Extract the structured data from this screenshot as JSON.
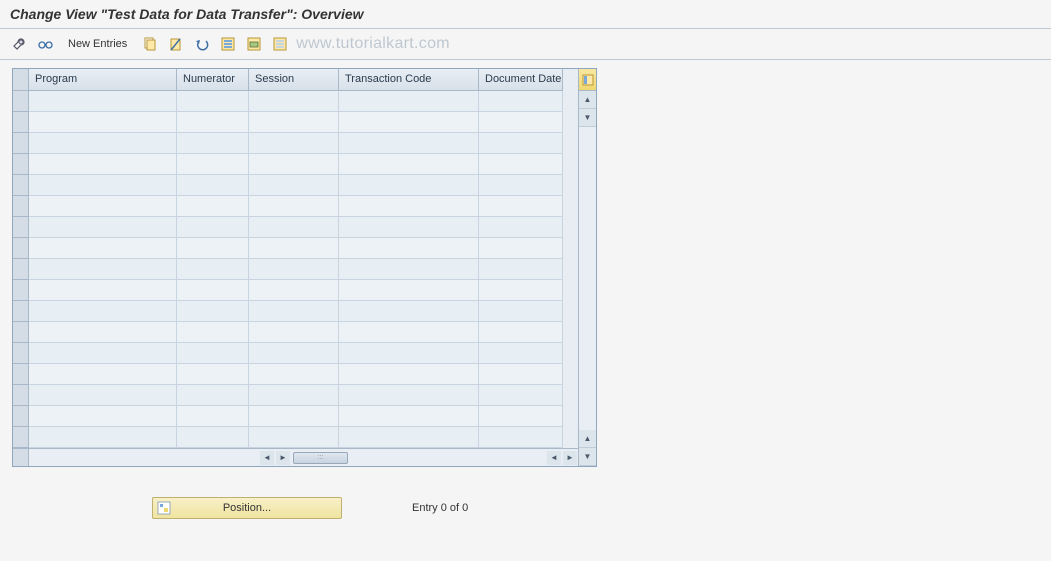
{
  "title": "Change View \"Test Data for Data Transfer\": Overview",
  "toolbar": {
    "new_entries_label": "New Entries"
  },
  "watermark": "www.tutorialkart.com",
  "grid": {
    "columns": {
      "program": "Program",
      "numerator": "Numerator",
      "session": "Session",
      "transaction_code": "Transaction Code",
      "document_date": "Document Date"
    },
    "rows": []
  },
  "position": {
    "button_label": "Position...",
    "entry_text": "Entry 0 of 0"
  }
}
